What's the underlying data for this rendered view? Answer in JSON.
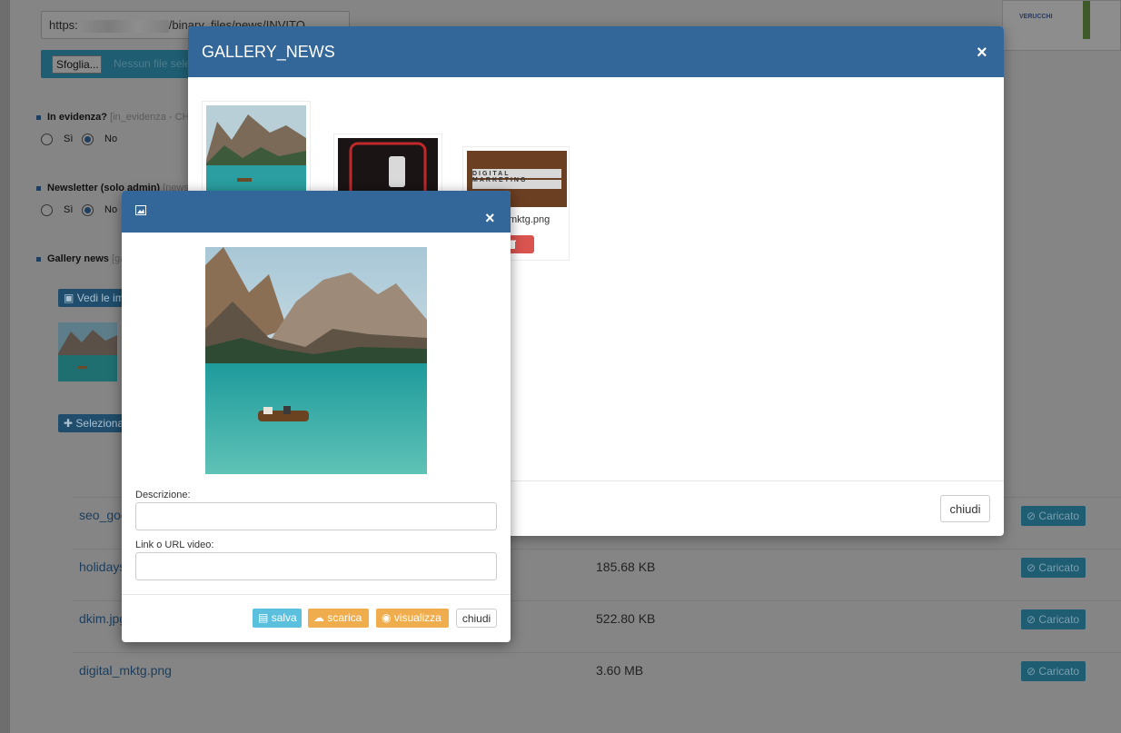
{
  "background": {
    "url_prefix": "https:",
    "url_suffix": "/binary_files/news/INVITO",
    "browse_label": "Sfoglia...",
    "no_file_label": "Nessun file selezionato.",
    "featured": {
      "label": "In evidenza?",
      "hint": "[in_evidenza - CH",
      "yes": "Sì",
      "no": "No"
    },
    "newsletter": {
      "label": "Newsletter (solo admin)",
      "hint": "[newsletter]",
      "yes": "Sì",
      "no": "No"
    },
    "gallery": {
      "label": "Gallery news",
      "hint": "[gallery]"
    },
    "view_images_label": "Vedi le immagini",
    "select_label": "Seleziona",
    "top_thumb_text": "VERUCCHI",
    "files": [
      {
        "name": "seo_google.jpg",
        "size": "",
        "status": "Caricato"
      },
      {
        "name": "holidays.jpg",
        "size": "185.68 KB",
        "status": "Caricato"
      },
      {
        "name": "dkim.jpg",
        "size": "522.80 KB",
        "status": "Caricato"
      },
      {
        "name": "digital_mktg.png",
        "size": "3.60 MB",
        "status": "Caricato"
      }
    ]
  },
  "gallery_modal": {
    "title": "GALLERY_NEWS",
    "close_icon": "×",
    "image_name_3": "mktg.png",
    "marketing_tile_text": "DIGITAL MARKETING",
    "delete_icon": "trash-icon",
    "close_label": "chiudi"
  },
  "image_modal": {
    "header_icon": "image-icon",
    "close_icon": "×",
    "description_label": "Descrizione:",
    "description_value": "",
    "video_label": "Link o URL video:",
    "video_value": "",
    "save_label": "salva",
    "download_label": "scarica",
    "view_label": "visualizza",
    "close_label": "chiudi"
  },
  "colors": {
    "header_blue": "#336699",
    "info": "#5bc0de",
    "warning": "#f0ad4e",
    "danger": "#d9534f",
    "success_status": "#1f5d73"
  }
}
